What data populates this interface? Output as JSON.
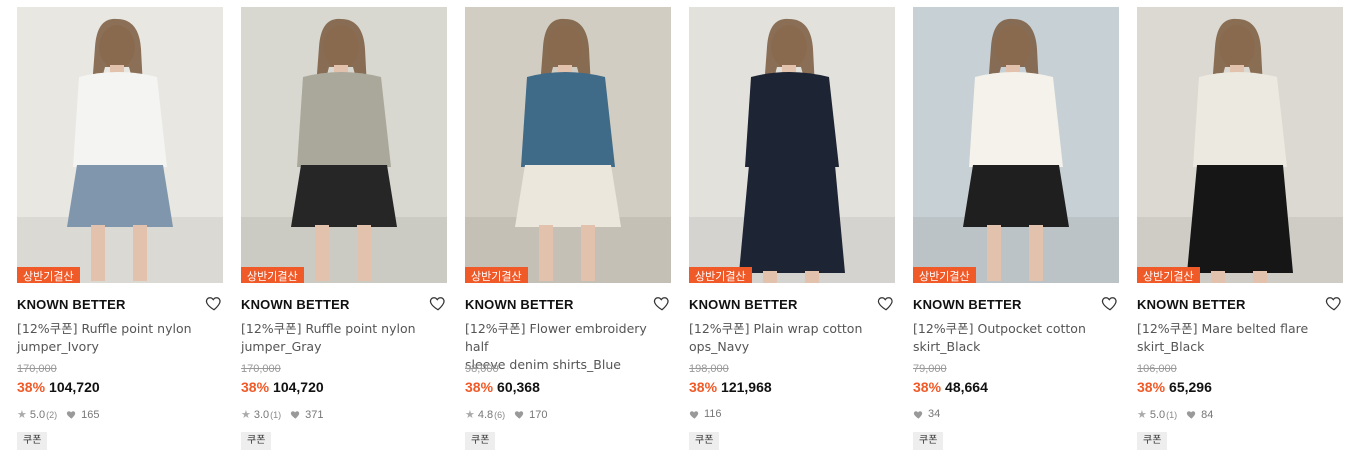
{
  "products": [
    {
      "badge": "상반기결산",
      "brand": "KNOWN BETTER",
      "name_line1": "[12%쿠폰] Ruffle point nylon",
      "name_line2": "jumper_Ivory",
      "original_price": "170,000",
      "discount": "38%",
      "price": "104,720",
      "rating": "5.0",
      "review_count": "(2)",
      "likes": "165",
      "coupon": "쿠폰",
      "colors": {
        "bg": "#e9e7e2",
        "top": "#f4f4f2",
        "bottom": "#7f96ad"
      }
    },
    {
      "badge": "상반기결산",
      "brand": "KNOWN BETTER",
      "name_line1": "[12%쿠폰] Ruffle point nylon",
      "name_line2": "jumper_Gray",
      "original_price": "170,000",
      "discount": "38%",
      "price": "104,720",
      "rating": "3.0",
      "review_count": "(1)",
      "likes": "371",
      "coupon": "쿠폰",
      "colors": {
        "bg": "#d8d7d0",
        "top": "#a9a89a",
        "bottom": "#262626"
      }
    },
    {
      "badge": "상반기결산",
      "brand": "KNOWN BETTER",
      "name_line1": "[12%쿠폰] Flower embroidery half",
      "name_line2": "sleeve denim shirts_Blue",
      "original_price": "98,000",
      "discount": "38%",
      "price": "60,368",
      "rating": "4.8",
      "review_count": "(6)",
      "likes": "170",
      "coupon": "쿠폰",
      "colors": {
        "bg": "#d2cdc2",
        "top": "#3f6a88",
        "bottom": "#ece7dc"
      }
    },
    {
      "badge": "상반기결산",
      "brand": "KNOWN BETTER",
      "name_line1": "[12%쿠폰] Plain wrap cotton",
      "name_line2": "ops_Navy",
      "original_price": "198,000",
      "discount": "38%",
      "price": "121,968",
      "rating": "",
      "review_count": "",
      "likes": "116",
      "coupon": "쿠폰",
      "colors": {
        "bg": "#e3e1dc",
        "top": "#1d2433",
        "bottom": "#1d2433"
      }
    },
    {
      "badge": "상반기결산",
      "brand": "KNOWN BETTER",
      "name_line1": "[12%쿠폰] Outpocket cotton",
      "name_line2": "skirt_Black",
      "original_price": "79,000",
      "discount": "38%",
      "price": "48,664",
      "rating": "",
      "review_count": "",
      "likes": "34",
      "coupon": "쿠폰",
      "colors": {
        "bg": "#c7d0d4",
        "top": "#f4f2ea",
        "bottom": "#1f1f1f"
      }
    },
    {
      "badge": "상반기결산",
      "brand": "KNOWN BETTER",
      "name_line1": "[12%쿠폰] Mare belted flare",
      "name_line2": "skirt_Black",
      "original_price": "106,000",
      "discount": "38%",
      "price": "65,296",
      "rating": "5.0",
      "review_count": "(1)",
      "likes": "84",
      "coupon": "쿠폰",
      "colors": {
        "bg": "#dcd9d2",
        "top": "#ece9e0",
        "bottom": "#161616"
      }
    }
  ],
  "accent_color": "#f05a28",
  "icons": {
    "wishlist": "heart-outline-icon",
    "rating": "star-icon",
    "likes": "heart-filled-icon"
  }
}
